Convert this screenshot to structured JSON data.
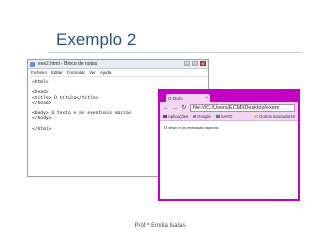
{
  "slide": {
    "title": "Exemplo 2",
    "footer": "Prof.ª Emília Isaías"
  },
  "notepad": {
    "title": "exe2.html - Bloco de notas",
    "menu": [
      "Ficheiro",
      "Editar",
      "Formatar",
      "Ver",
      "Ajuda"
    ],
    "lines": [
      "<html>",
      "",
      "<head>",
      "<title> O título</title>",
      "</head>",
      "",
      "<body> O texto e as eventuais marcas",
      "</body>",
      "",
      "</html>"
    ],
    "window_buttons": [
      "minimize-icon",
      "maximize-icon",
      "close-icon"
    ]
  },
  "browser": {
    "tab_title": "O título",
    "address": "file:///C:/Users/ECMI/Desktop/exem",
    "bookmarks": [
      "Aplicações",
      "Google",
      "SAPO"
    ],
    "other_bookmarks": "Outros marcadores",
    "page_text": "O texto e as eventuais marcas",
    "frame_color": "#c400c4"
  }
}
